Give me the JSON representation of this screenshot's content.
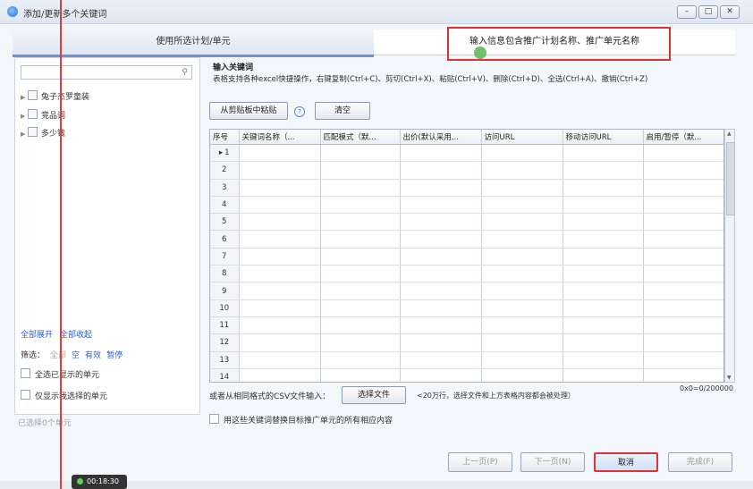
{
  "window": {
    "title": "添加/更新多个关键词",
    "min": "–",
    "max": "□",
    "close": "✕"
  },
  "tabs": [
    {
      "label": "使用所选计划/单元"
    },
    {
      "label": "输入信息包含推广计划名称、推广单元名称"
    }
  ],
  "left": {
    "search_placeholder": "",
    "tree": [
      {
        "label": "兔子杰罗童装"
      },
      {
        "label": "竞品词"
      },
      {
        "label": "多少钱"
      }
    ],
    "expand_all": "全部展开",
    "collapse_all": "全部收起",
    "filter_label": "筛选：",
    "filter_all": "全部",
    "filter_empty": "空",
    "filter_valid": "有效",
    "filter_paused": "暂停",
    "select_all_shown": "全选已显示的单元",
    "show_selected_only": "仅显示我选择的单元",
    "selected_count": "已选择0个单元"
  },
  "right": {
    "title": "输入关键词",
    "hint": "表格支持各种excel快捷操作，右键复制(Ctrl+C)、剪切(Ctrl+X)、粘贴(Ctrl+V)、删除(Ctrl+D)、全选(Ctrl+A)、撤销(Ctrl+Z)",
    "paste_button": "从剪贴板中粘贴",
    "help": "?",
    "clear_button": "清空",
    "columns": [
      "序号",
      "关键词名称（...",
      "匹配模式（默...",
      "出价(默认采用...",
      "访问URL",
      "移动访问URL",
      "启用/暂停（默..."
    ],
    "rows": [
      "1",
      "2",
      "3",
      "4",
      "5",
      "6",
      "7",
      "8",
      "9",
      "10",
      "11",
      "12",
      "13",
      "14"
    ],
    "current_row_marker": "▸",
    "counter": "0x0=0/200000",
    "csv_label": "或者从相同格式的CSV文件输入：",
    "choose_file": "选择文件",
    "csv_note": "<20万行，选择文件和上方表格内容都会被处理）",
    "replace_label": "用这些关键词替换目标推广单元的所有相应内容"
  },
  "footer": {
    "prev": "上一页(P)",
    "next": "下一页(N)",
    "cancel": "取消",
    "finish": "完成(F)"
  },
  "overlay": {
    "timer": "00:18:30"
  },
  "colors": {
    "accent": "#6f8fd6",
    "link": "#2f5fd0",
    "highlight_box": "#e03030"
  }
}
